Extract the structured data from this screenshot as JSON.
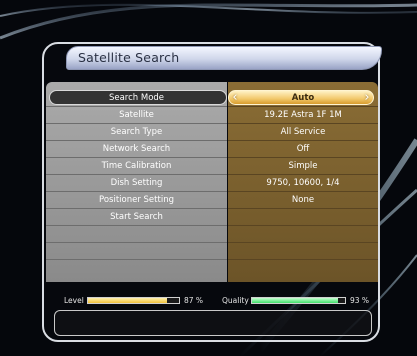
{
  "title": "Satellite Search",
  "menu": {
    "selected_index": 0,
    "rows": [
      {
        "label": "Search Mode",
        "value": "Auto"
      },
      {
        "label": "Satellite",
        "value": "19.2E Astra 1F 1M"
      },
      {
        "label": "Search Type",
        "value": "All Service"
      },
      {
        "label": "Network Search",
        "value": "Off"
      },
      {
        "label": "Time Calibration",
        "value": "Simple"
      },
      {
        "label": "Dish Setting",
        "value": "9750, 10600, 1/4"
      },
      {
        "label": "Positioner Setting",
        "value": "None"
      },
      {
        "label": "Start Search",
        "value": ""
      }
    ]
  },
  "signal": {
    "level_label": "Level",
    "level_value": "87 %",
    "level_fraction": 0.87,
    "quality_label": "Quality",
    "quality_value": "93 %",
    "quality_fraction": 0.93,
    "colors": {
      "level": "#f0c23a",
      "quality": "#3fe06a"
    }
  },
  "theme": {
    "selection_accent": "#f2c86b",
    "value_column": "#7a5f2e",
    "label_column": "#9a9a9a"
  },
  "icons": {
    "arrow_left": "‹",
    "arrow_right": "›"
  }
}
